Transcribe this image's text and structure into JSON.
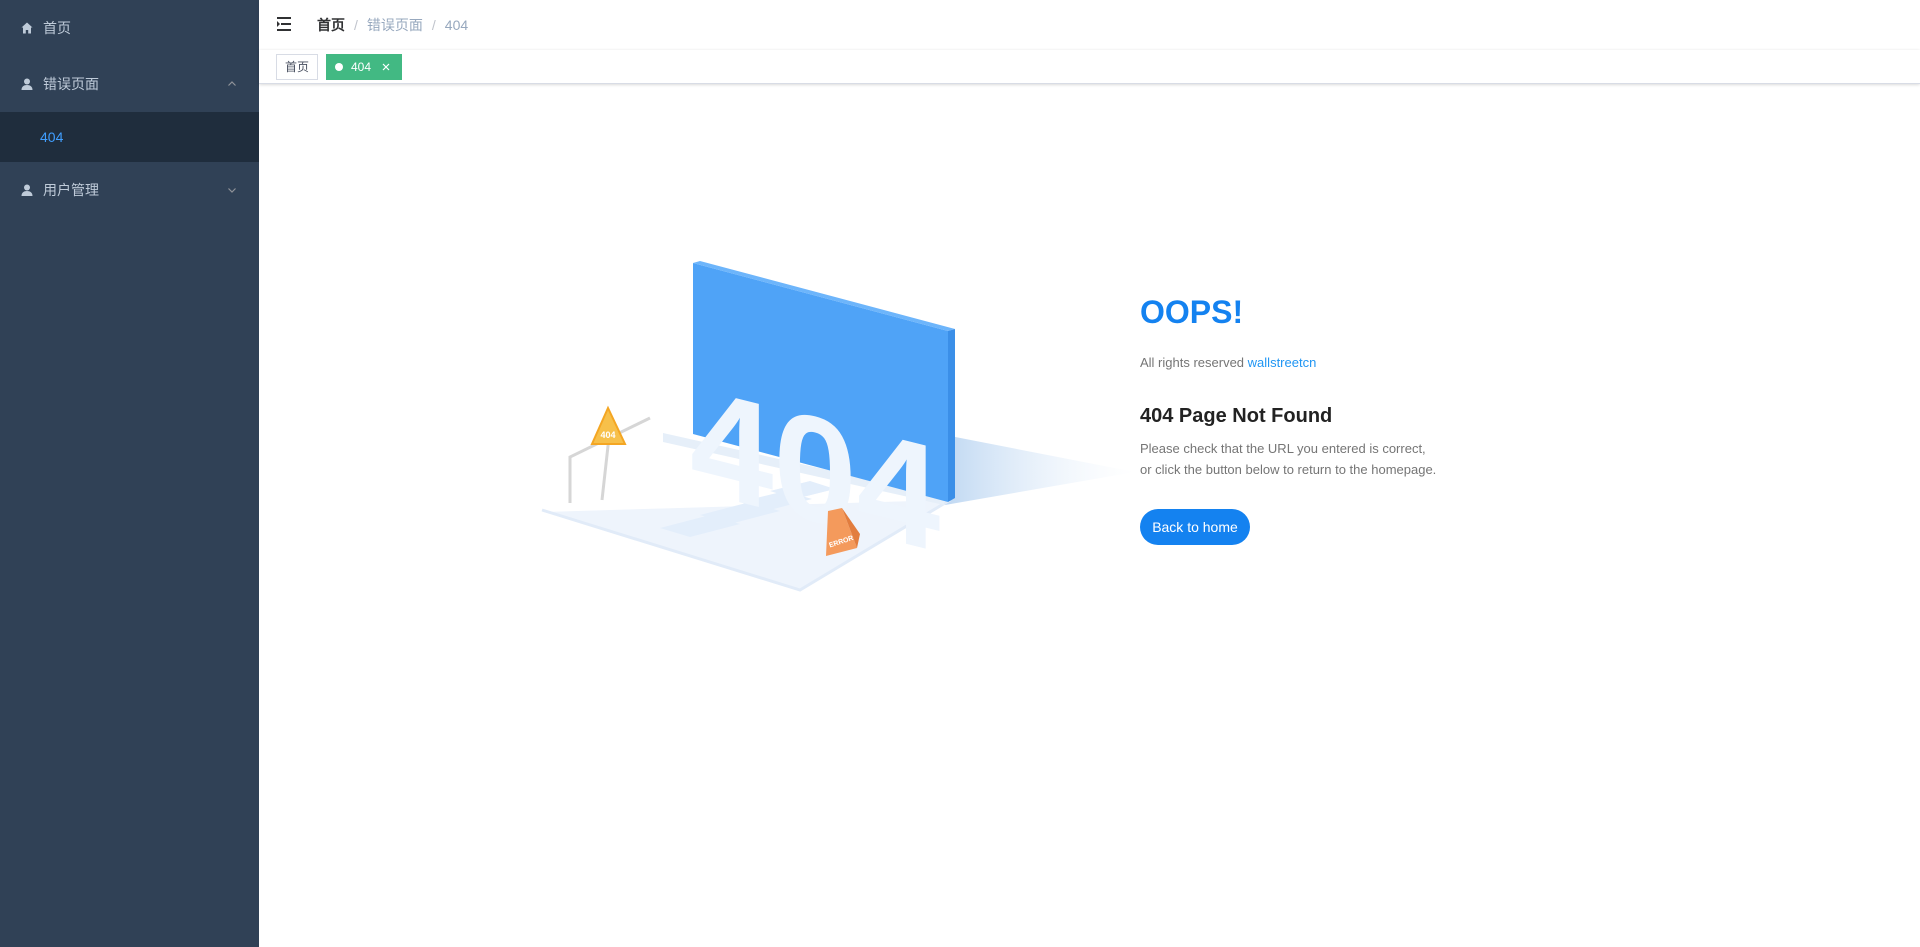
{
  "sidebar": {
    "items": [
      {
        "label": "首页",
        "icon": "home-icon"
      },
      {
        "label": "错误页面",
        "icon": "user-icon",
        "expanded": true,
        "children": [
          {
            "label": "404",
            "active": true
          }
        ]
      },
      {
        "label": "用户管理",
        "icon": "user-icon",
        "expanded": false
      }
    ]
  },
  "navbar": {
    "breadcrumb": [
      "首页",
      "错误页面",
      "404"
    ],
    "separator": "/"
  },
  "tags": [
    {
      "label": "首页",
      "active": false
    },
    {
      "label": "404",
      "active": true
    }
  ],
  "error_page": {
    "illustration_text": "404",
    "sign_text": "404",
    "cone_text": "ERROR",
    "oops": "OOPS!",
    "info_prefix": "All rights reserved",
    "info_link": "wallstreetcn",
    "headline": "404 Page Not Found",
    "message_line1": "Please check that the URL you entered is correct,",
    "message_line2": "or click the button below to return to the homepage.",
    "button": "Back to home"
  },
  "colors": {
    "sidebar_bg": "#304156",
    "sidebar_text": "#bfcbd9",
    "active_menu": "#409eff",
    "tag_active": "#42b983",
    "accent": "#1482f0"
  }
}
